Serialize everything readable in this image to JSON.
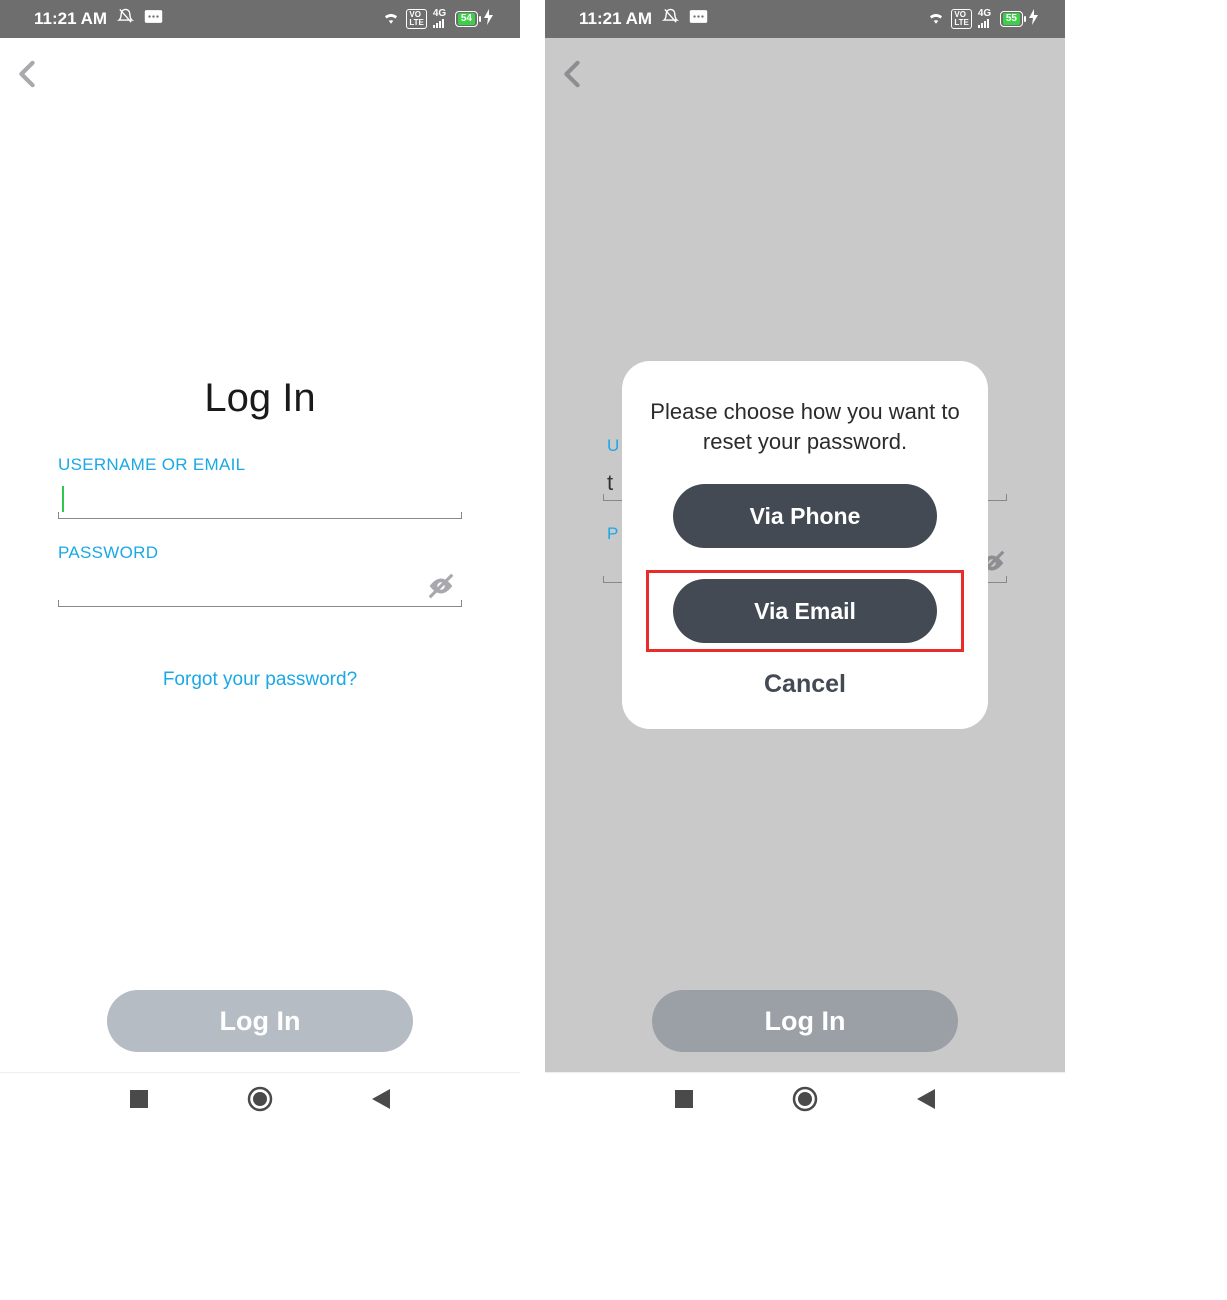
{
  "left": {
    "status": {
      "time": "11:21 AM",
      "battery": "54",
      "network": "4G"
    },
    "login": {
      "title": "Log In",
      "username_label": "USERNAME OR EMAIL",
      "username_value": "",
      "password_label": "PASSWORD",
      "password_value": "",
      "forgot_link": "Forgot your password?",
      "login_button": "Log In"
    }
  },
  "right": {
    "status": {
      "time": "11:21 AM",
      "battery": "55",
      "network": "4G"
    },
    "login": {
      "username_partial_label": "U",
      "username_partial_value": "t",
      "password_partial_label": "P",
      "login_button": "Log In"
    },
    "modal": {
      "prompt": "Please choose how you want to reset your password.",
      "via_phone": "Via Phone",
      "via_email": "Via Email",
      "cancel": "Cancel"
    }
  }
}
